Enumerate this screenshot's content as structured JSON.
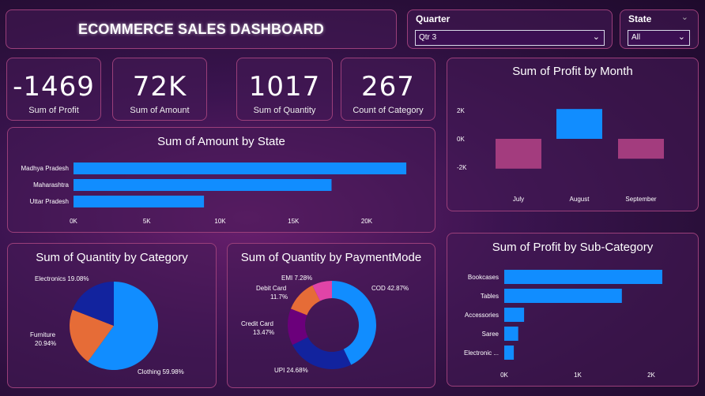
{
  "header": {
    "title": "ECOMMERCE SALES DASHBOARD"
  },
  "slicers": {
    "quarter": {
      "label": "Quarter",
      "value": "Qtr 3"
    },
    "state": {
      "label": "State",
      "value": "All"
    }
  },
  "kpis": [
    {
      "value": "-1469",
      "label": "Sum of Profit"
    },
    {
      "value": "72K",
      "label": "Sum of Amount"
    },
    {
      "value": "1017",
      "label": "Sum of Quantity"
    },
    {
      "value": "267",
      "label": "Count of Category"
    }
  ],
  "colors": {
    "blue": "#118dff",
    "magenta": "#a33c7e",
    "darkblue": "#12239e",
    "orange": "#e66c37",
    "purple": "#6b007b",
    "pink": "#e044a7"
  },
  "chart_data": [
    {
      "id": "profit_by_month",
      "type": "bar",
      "title": "Sum of Profit by Month",
      "categories": [
        "July",
        "August",
        "September"
      ],
      "values": [
        -2100,
        2100,
        -1400
      ],
      "yticks": [
        "2K",
        "0K",
        "-2K"
      ],
      "ylim": [
        -2500,
        2500
      ]
    },
    {
      "id": "amount_by_state",
      "type": "bar",
      "orientation": "horizontal",
      "title": "Sum of Amount by State",
      "categories": [
        "Madhya Pradesh",
        "Maharashtra",
        "Uttar Pradesh"
      ],
      "values": [
        22700,
        17600,
        8900
      ],
      "xticks": [
        "0K",
        "5K",
        "10K",
        "15K",
        "20K"
      ],
      "xlim": [
        0,
        20000
      ]
    },
    {
      "id": "quantity_by_category",
      "type": "pie",
      "title": "Sum of Quantity by Category",
      "labels": [
        "Clothing",
        "Furniture",
        "Electronics"
      ],
      "values": [
        59.98,
        20.94,
        19.08
      ],
      "data_labels": [
        "Clothing 59.98%",
        "Furniture",
        "20.94%",
        "Electronics 19.08%"
      ]
    },
    {
      "id": "quantity_by_paymentmode",
      "type": "pie",
      "donut": true,
      "title": "Sum of Quantity by PaymentMode",
      "labels": [
        "COD",
        "UPI",
        "Credit Card",
        "Debit Card",
        "EMI"
      ],
      "values": [
        42.87,
        24.68,
        13.47,
        11.7,
        7.28
      ],
      "data_labels": [
        "COD 42.87%",
        "UPI 24.68%",
        "Credit Card",
        "13.47%",
        "Debit Card",
        "11.7%",
        "EMI 7.28%"
      ]
    },
    {
      "id": "profit_by_subcategory",
      "type": "bar",
      "orientation": "horizontal",
      "title": "Sum of Profit by Sub-Category",
      "categories": [
        "Bookcases",
        "Tables",
        "Accessories",
        "Saree",
        "Electronic ..."
      ],
      "values": [
        2150,
        1600,
        270,
        190,
        130
      ],
      "xticks": [
        "0K",
        "1K",
        "2K"
      ],
      "xlim": [
        0,
        2000
      ]
    }
  ]
}
